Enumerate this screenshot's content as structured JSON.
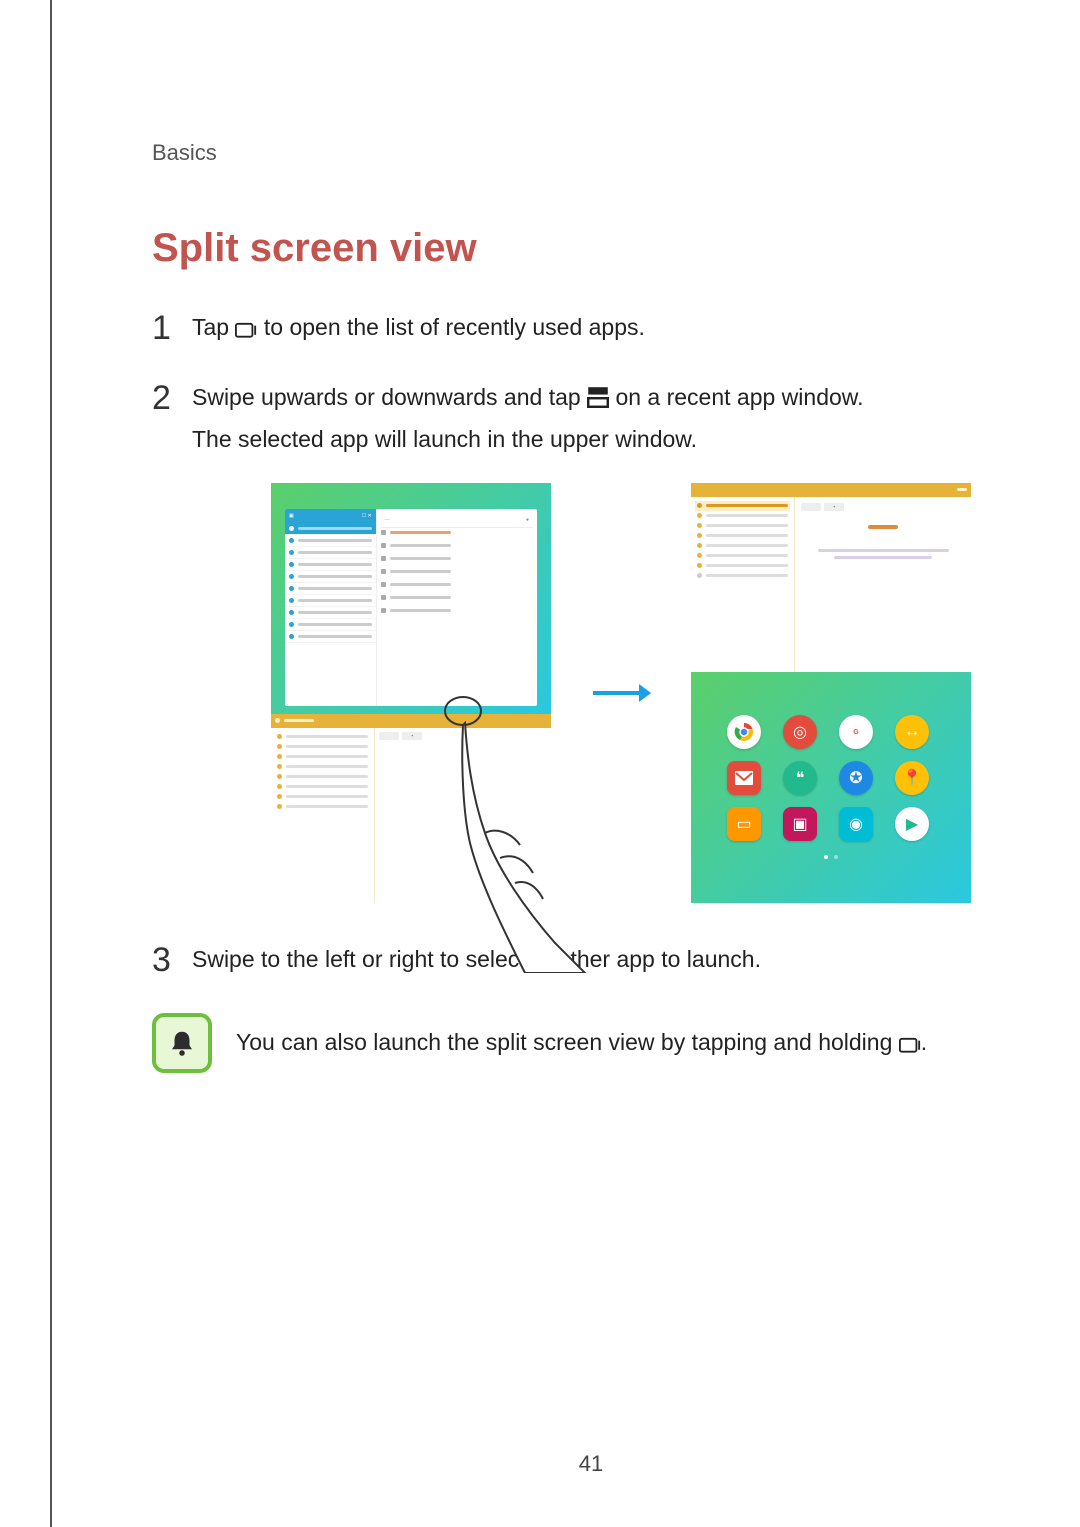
{
  "header": {
    "section": "Basics"
  },
  "title": "Split screen view",
  "steps": {
    "s1": {
      "num": "1",
      "pre": "Tap ",
      "post": " to open the list of recently used apps."
    },
    "s2": {
      "num": "2",
      "pre": "Swipe upwards or downwards and tap ",
      "post": " on a recent app window.",
      "line2": "The selected app will launch in the upper window."
    },
    "s3": {
      "num": "3",
      "text": "Swipe to the left or right to select another app to launch."
    }
  },
  "note": {
    "pre": "You can also launch the split screen view by tapping and holding ",
    "post": "."
  },
  "page_number": "41",
  "icons": {
    "recent_apps": "recent-apps-icon",
    "split_view": "split-view-icon",
    "notice_bell": "bell-icon"
  },
  "illustration": {
    "apps": [
      {
        "name": "chrome",
        "bg": "#ffffff",
        "glyph_color": "#4285F4"
      },
      {
        "name": "target",
        "bg": "#e34b3d"
      },
      {
        "name": "galaxy",
        "bg": "#ffffff"
      },
      {
        "name": "swap",
        "bg": "#ffc107"
      },
      {
        "name": "gmail",
        "bg": "#e34b3d"
      },
      {
        "name": "quote",
        "bg": "#22b98c"
      },
      {
        "name": "globe",
        "bg": "#1e88e5"
      },
      {
        "name": "maps",
        "bg": "#ffc107"
      },
      {
        "name": "folder",
        "bg": "#ff9800"
      },
      {
        "name": "video",
        "bg": "#c2185b"
      },
      {
        "name": "photo",
        "bg": "#00bcd4"
      },
      {
        "name": "play",
        "bg": "#ffffff"
      }
    ]
  }
}
